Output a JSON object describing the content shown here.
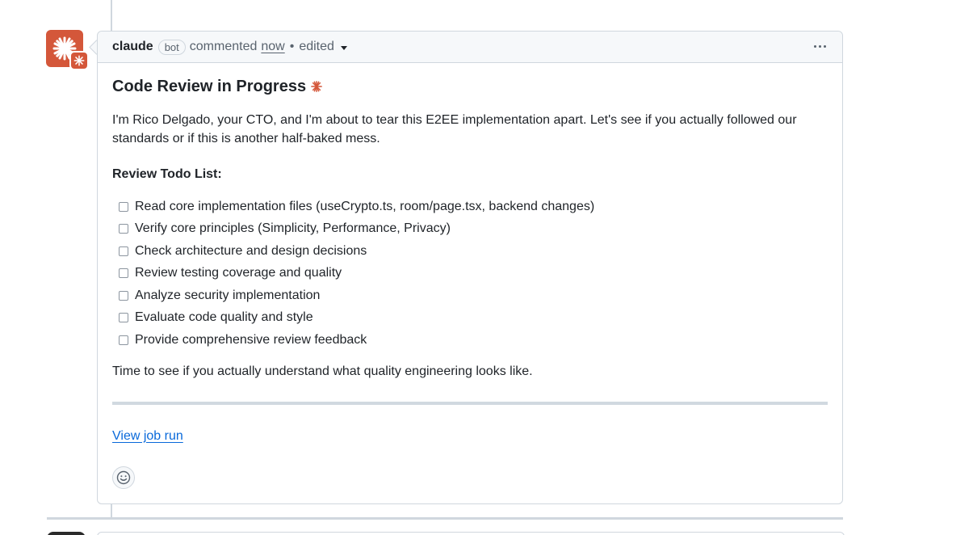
{
  "comment": {
    "author": "claude",
    "author_label": "bot",
    "action": "commented",
    "time": "now",
    "separator": "•",
    "edited": "edited",
    "heading": "Code Review in Progress",
    "intro": "I'm Rico Delgado, your CTO, and I'm about to tear this E2EE implementation apart. Let's see if you actually followed our standards or if this is another half-baked mess.",
    "todo_title": "Review Todo List:",
    "todos": [
      {
        "label": "Read core implementation files (useCrypto.ts, room/page.tsx, backend changes)",
        "checked": false
      },
      {
        "label": "Verify core principles (Simplicity, Performance, Privacy)",
        "checked": false
      },
      {
        "label": "Check architecture and design decisions",
        "checked": false
      },
      {
        "label": "Review testing coverage and quality",
        "checked": false
      },
      {
        "label": "Analyze security implementation",
        "checked": false
      },
      {
        "label": "Evaluate code quality and style",
        "checked": false
      },
      {
        "label": "Provide comprehensive review feedback",
        "checked": false
      }
    ],
    "closing": "Time to see if you actually understand what quality engineering looks like.",
    "job_link": "View job run"
  },
  "icons": {
    "avatar": "claude-spark-icon",
    "heading_spark": "spark-icon",
    "menu": "kebab-horizontal-icon",
    "reaction": "smiley-icon"
  },
  "colors": {
    "brand": "#d4573a",
    "link": "#0969da",
    "border": "#d0d7de",
    "header_bg": "#f6f8fa"
  }
}
